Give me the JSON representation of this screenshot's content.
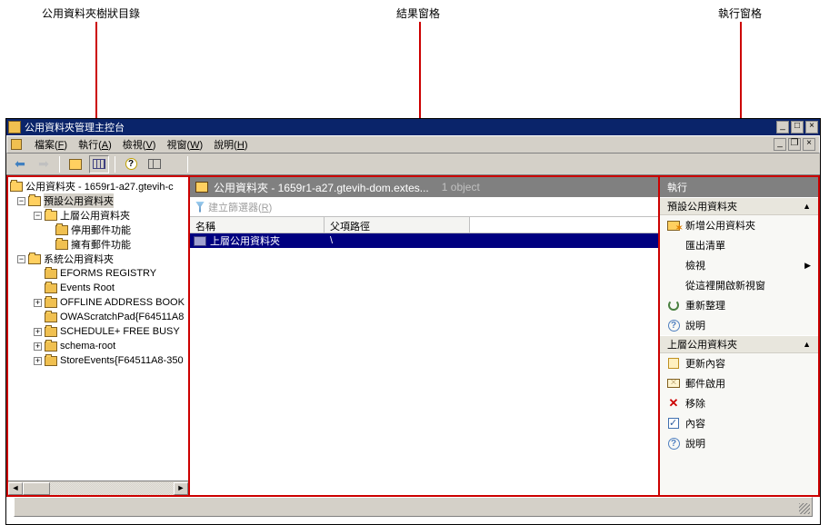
{
  "annotations": {
    "tree": "公用資料夾樹狀目錄",
    "result": "結果窗格",
    "action": "執行窗格"
  },
  "window": {
    "title": "公用資料夾管理主控台"
  },
  "menu": {
    "file": "檔案(",
    "file_u": "F",
    "file_end": ")",
    "action": "執行(",
    "action_u": "A",
    "action_end": ")",
    "view": "檢視(",
    "view_u": "V",
    "view_end": ")",
    "window_m": "視窗(",
    "window_m_u": "W",
    "window_m_end": ")",
    "help": "說明(",
    "help_u": "H",
    "help_end": ")"
  },
  "tree": {
    "root": "公用資料夾 - 1659r1-a27.gtevih-c",
    "default_pf": "預設公用資料夾",
    "top_pf": "上層公用資料夾",
    "suspend_mail": "停用郵件功能",
    "has_mail": "擁有郵件功能",
    "system_pf": "系統公用資料夾",
    "sys_items": [
      "EFORMS REGISTRY",
      "Events Root",
      "OFFLINE ADDRESS BOOK",
      "OWAScratchPad{F64511A8",
      "SCHEDULE+ FREE BUSY",
      "schema-root",
      "StoreEvents{F64511A8-350"
    ]
  },
  "result": {
    "title": "公用資料夾 - 1659r1-a27.gtevih-dom.extes...",
    "count": "1 object",
    "filter_label": "建立篩選器(",
    "filter_u": "R",
    "filter_end": ")",
    "col_name": "名稱",
    "col_parent": "父項路徑",
    "rows": [
      {
        "name": "上層公用資料夾",
        "parent": "\\"
      }
    ]
  },
  "actions": {
    "header": "執行",
    "section1": "預設公用資料夾",
    "new_pf": "新增公用資料夾",
    "export_list": "匯出清單",
    "view": "檢視",
    "open_new_window": "從這裡開啟新視窗",
    "refresh": "重新整理",
    "help": "說明",
    "section2": "上層公用資料夾",
    "update_content": "更新內容",
    "mail_enable": "郵件啟用",
    "remove": "移除",
    "properties": "內容",
    "help2": "說明"
  }
}
